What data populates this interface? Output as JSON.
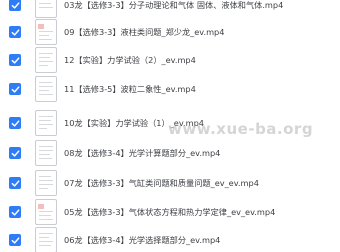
{
  "files": [
    {
      "name": "03龙【选修3-3】分子动理论和气体 固体、液体和气体.mp4",
      "checked": true
    },
    {
      "name": "09【选修3-3】液柱类问题_郑少龙_ev.mp4",
      "checked": true
    },
    {
      "name": "12【实验】力学试验（2）_ev.mp4",
      "checked": true
    },
    {
      "name": "11【选修3-5】波粒二象性_ev.mp4",
      "checked": true
    },
    {
      "name": "10龙【实验】力学试验（1）_ev.mp4",
      "checked": true
    },
    {
      "name": "08龙【选修3-4】光学计算题部分_ev.mp4",
      "checked": true
    },
    {
      "name": "07龙【选修3-3】气缸类问题和质量问题_ev_ev.mp4",
      "checked": true
    },
    {
      "name": "05龙【选修3-3】气体状态方程和热力学定律_ev_ev.mp4",
      "checked": true
    },
    {
      "name": "06龙【选修3-4】光学选择题部分_ev.mp4",
      "checked": true
    }
  ],
  "watermark": "www.xue-ba.org",
  "colors": {
    "checkbox": "#2e7cf6",
    "text": "#3d3f44"
  },
  "icons": {
    "checkbox": "check-icon",
    "thumbnail": "document-thumbnail-icon"
  }
}
